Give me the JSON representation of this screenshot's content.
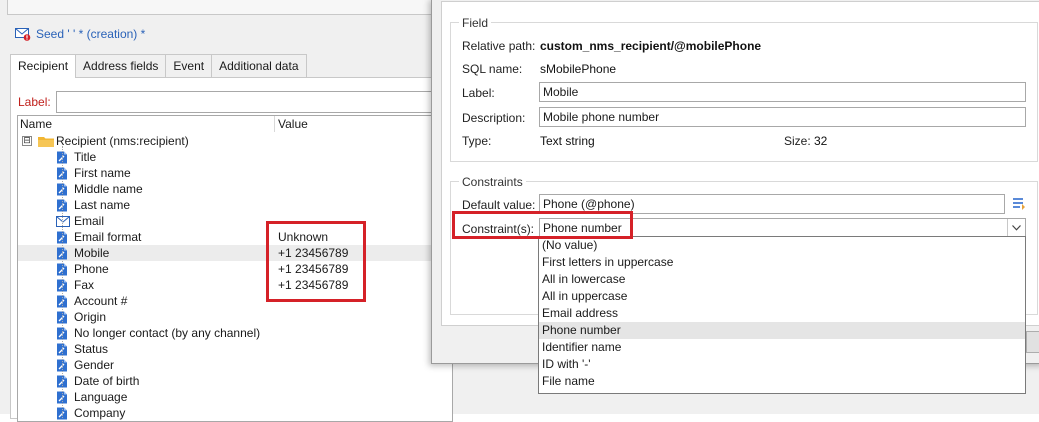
{
  "document": {
    "title": "Seed ' ' * (creation) *"
  },
  "tabs": [
    {
      "label": "Recipient",
      "active": true
    },
    {
      "label": "Address fields",
      "active": false
    },
    {
      "label": "Event",
      "active": false
    },
    {
      "label": "Additional data",
      "active": false
    }
  ],
  "form": {
    "label_label": "Label:",
    "label_value": ""
  },
  "tree": {
    "col_name": "Name",
    "col_value": "Value",
    "root": {
      "label": "Recipient (nms:recipient)",
      "expander": "⊟"
    },
    "items": [
      {
        "label": "Title",
        "value": "",
        "icon": "field-icon"
      },
      {
        "label": "First name",
        "value": "",
        "icon": "field-icon"
      },
      {
        "label": "Middle name",
        "value": "",
        "icon": "field-icon"
      },
      {
        "label": "Last name",
        "value": "",
        "icon": "field-icon"
      },
      {
        "label": "Email",
        "value": "",
        "icon": "email-icon"
      },
      {
        "label": "Email format",
        "value": "Unknown",
        "icon": "field-icon"
      },
      {
        "label": "Mobile",
        "value": "+1 23456789",
        "icon": "field-icon",
        "selected": true
      },
      {
        "label": "Phone",
        "value": "+1 23456789",
        "icon": "field-icon"
      },
      {
        "label": "Fax",
        "value": "+1 23456789",
        "icon": "field-icon"
      },
      {
        "label": "Account #",
        "value": "",
        "icon": "field-icon"
      },
      {
        "label": "Origin",
        "value": "",
        "icon": "field-icon"
      },
      {
        "label": "No longer contact (by any channel)",
        "value": "",
        "icon": "field-icon"
      },
      {
        "label": "Status",
        "value": "",
        "icon": "field-icon"
      },
      {
        "label": "Gender",
        "value": "",
        "icon": "field-icon"
      },
      {
        "label": "Date of birth",
        "value": "",
        "icon": "field-icon"
      },
      {
        "label": "Language",
        "value": "",
        "icon": "field-icon"
      },
      {
        "label": "Company",
        "value": "",
        "icon": "field-icon"
      }
    ]
  },
  "field": {
    "group_title": "Field",
    "relative_path_label": "Relative path:",
    "relative_path": "custom_nms_recipient/@mobilePhone",
    "sql_name_label": "SQL name:",
    "sql_name": "sMobilePhone",
    "label_label": "Label:",
    "label": "Mobile",
    "description_label": "Description:",
    "description": "Mobile phone number",
    "type_label": "Type:",
    "type": "Text string",
    "size_label": "Size:",
    "size": "32"
  },
  "constraints": {
    "group_title": "Constraints",
    "default_value_label": "Default value:",
    "default_value": "Phone (@phone)",
    "constraint_label": "Constraint(s):",
    "constraint_value": "Phone number",
    "options": [
      {
        "label": "(No value)"
      },
      {
        "label": "First letters in uppercase"
      },
      {
        "label": "All in lowercase"
      },
      {
        "label": "All in uppercase"
      },
      {
        "label": "Email address"
      },
      {
        "label": "Phone number",
        "highlighted": true
      },
      {
        "label": "Identifier name"
      },
      {
        "label": "ID with '-'"
      },
      {
        "label": "File name"
      }
    ]
  },
  "colors": {
    "accent": "#2a62b8",
    "highlight_box": "#d52128",
    "label_red": "#c0201c",
    "folder": "#f2b632"
  }
}
